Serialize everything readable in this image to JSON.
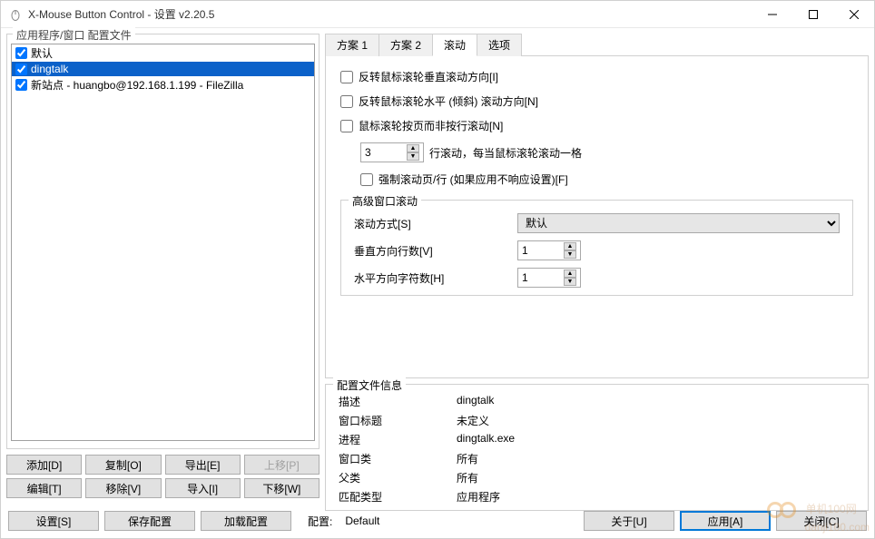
{
  "window": {
    "title": "X-Mouse Button Control - 设置 v2.20.5"
  },
  "left": {
    "frame_label": "应用程序/窗口 配置文件",
    "profiles": [
      {
        "label": "默认",
        "checked": true,
        "selected": false
      },
      {
        "label": "dingtalk",
        "checked": true,
        "selected": true
      },
      {
        "label": "新站点 - huangbo@192.168.1.199 - FileZilla",
        "checked": true,
        "selected": false
      }
    ],
    "buttons": {
      "add": "添加[D]",
      "copy": "复制[O]",
      "export": "导出[E]",
      "up": "上移[P]",
      "edit": "编辑[T]",
      "remove": "移除[V]",
      "import": "导入[I]",
      "down": "下移[W]"
    }
  },
  "tabs": {
    "items": [
      "方案 1",
      "方案 2",
      "滚动",
      "选项"
    ],
    "active_index": 2
  },
  "scroll": {
    "cb_invert_v": "反转鼠标滚轮垂直滚动方向[I]",
    "cb_invert_h": "反转鼠标滚轮水平 (倾斜) 滚动方向[N]",
    "cb_page": "鼠标滚轮按页而非按行滚动[N]",
    "lines_value": "3",
    "lines_suffix": "行滚动，每当鼠标滚轮滚动一格",
    "cb_force": "强制滚动页/行 (如果应用不响应设置)[F]",
    "group_label": "高级窗口滚动",
    "method_label": "滚动方式[S]",
    "method_value": "默认",
    "vlines_label": "垂直方向行数[V]",
    "vlines_value": "1",
    "hchars_label": "水平方向字符数[H]",
    "hchars_value": "1"
  },
  "info": {
    "frame_label": "配置文件信息",
    "rows": {
      "desc_label": "描述",
      "desc_value": "dingtalk",
      "title_label": "窗口标题",
      "title_value": "未定义",
      "proc_label": "进程",
      "proc_value": "dingtalk.exe",
      "class_label": "窗口类",
      "class_value": "所有",
      "parent_label": "父类",
      "parent_value": "所有",
      "match_label": "匹配类型",
      "match_value": "应用程序"
    }
  },
  "bottom": {
    "settings": "设置[S]",
    "save": "保存配置",
    "load": "加载配置",
    "config_label": "配置:",
    "config_value": "Default",
    "about": "关于[U]",
    "apply": "应用[A]",
    "close": "关闭[C]"
  },
  "watermark": {
    "line1": "单机100网",
    "line2": "danji100.com"
  }
}
